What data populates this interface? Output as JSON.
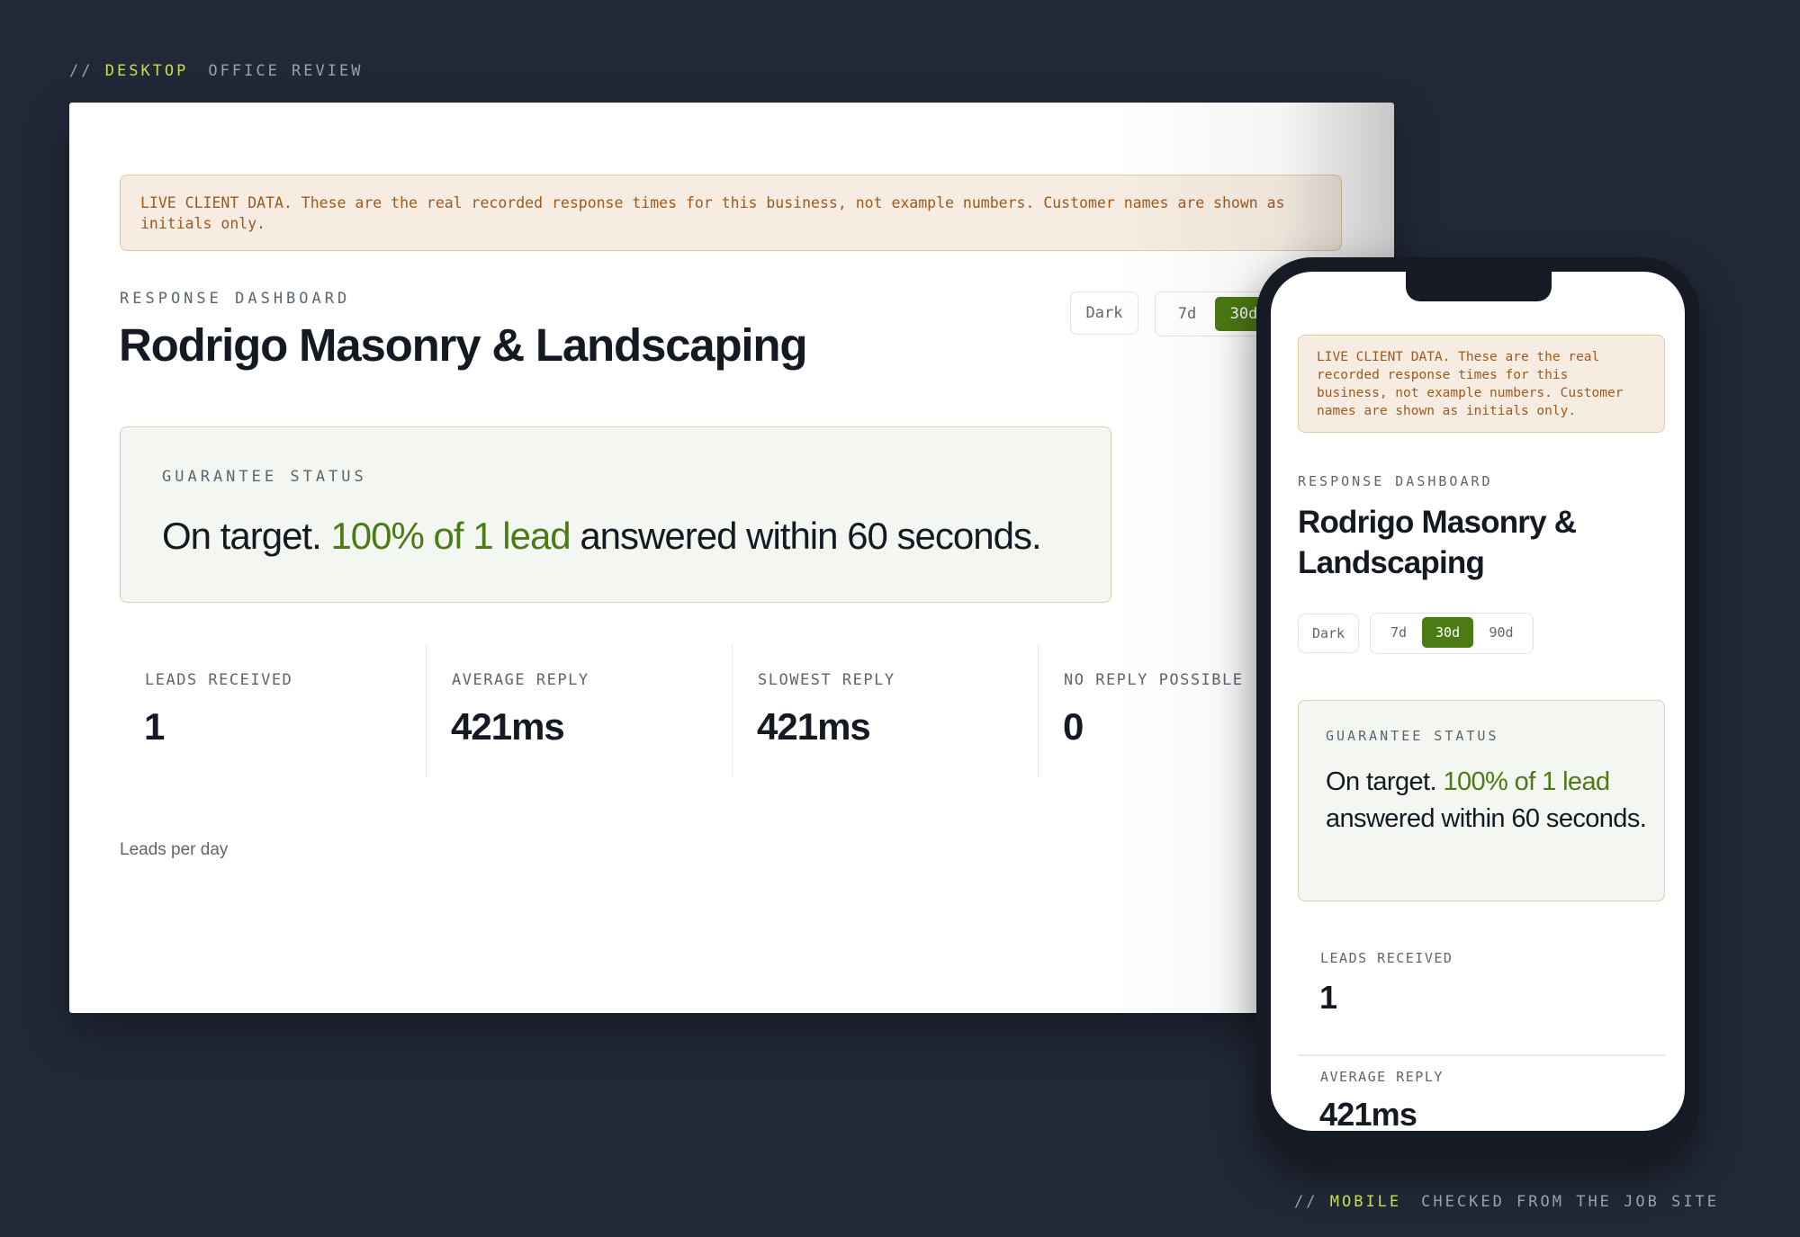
{
  "captions": {
    "desktop": {
      "slash": "//",
      "device": "DESKTOP",
      "context": "OFFICE REVIEW"
    },
    "mobile": {
      "slash": "//",
      "device": "MOBILE",
      "context": "CHECKED FROM THE JOB SITE"
    }
  },
  "notice": {
    "text": "LIVE CLIENT DATA. These are the real recorded response times for this business, not example numbers. Customer names are shown as initials only."
  },
  "header": {
    "kicker": "RESPONSE DASHBOARD",
    "title": "Rodrigo Masonry & Landscaping"
  },
  "controls": {
    "theme_label": "Dark",
    "ranges": [
      "7d",
      "30d",
      "90d"
    ],
    "active_range": "30d"
  },
  "guarantee": {
    "kicker": "GUARANTEE STATUS",
    "lead_text": "On target.",
    "highlight": "100% of 1 lead",
    "tail_text": "answered within 60 seconds."
  },
  "stats": [
    {
      "label": "LEADS RECEIVED",
      "value": "1",
      "accent": false
    },
    {
      "label": "AVERAGE REPLY",
      "value": "421ms",
      "accent": true
    },
    {
      "label": "SLOWEST REPLY",
      "value": "421ms",
      "accent": false
    },
    {
      "label": "NO REPLY POSSIBLE",
      "value": "0",
      "accent": false
    }
  ],
  "chart": {
    "title": "Leads per day"
  },
  "colors": {
    "accent_green": "#4c7a14",
    "caption_accent": "#c4e04a",
    "notice_text": "#a0591c",
    "background": "#222837"
  }
}
